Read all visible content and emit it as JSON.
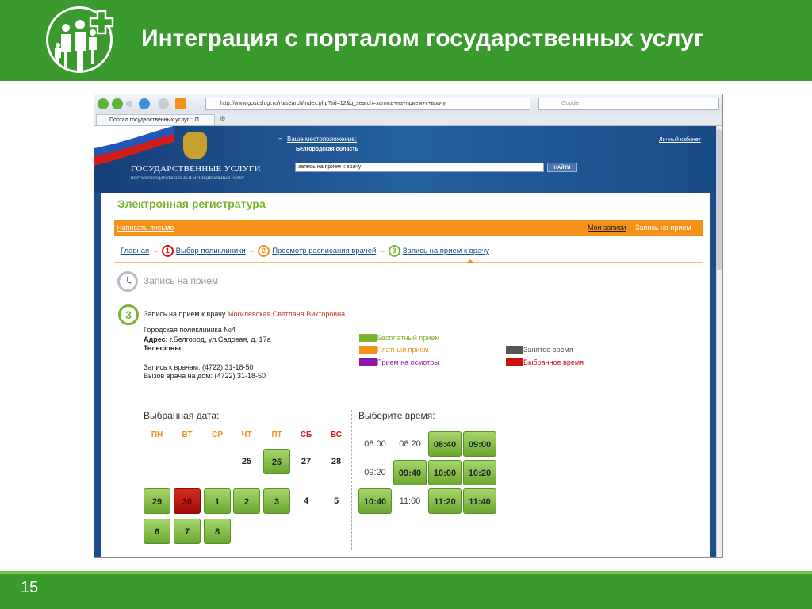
{
  "slide": {
    "title": "Интеграция с порталом государственных услуг",
    "page_number": "15",
    "colors": {
      "brand_green": "#3a9a2e",
      "light_green": "#7bc143"
    }
  },
  "browser": {
    "url": "http://www.gosuslugi.ru/ru/search/index.php?tid=12&q_search=запись+на+прием+к+врачу",
    "search_engine": "Google",
    "tab_title": "Портал государственных услуг :: П..."
  },
  "portal": {
    "location_label": "Ваше местоположение:",
    "location_value": "Белгородская область",
    "title": "ГОСУДАРСТВЕННЫЕ УСЛУГИ",
    "subtitle": "ПОРТАЛ ГОСУДАРСТВЕННЫХ И МУНИЦИПАЛЬНЫХ УСЛУГ",
    "search_value": "запись на прием к врачу",
    "search_button": "НАЙТИ",
    "cabinet_link": "Личный кабинет"
  },
  "registry": {
    "title": "Электронная регистратура",
    "write_letter": "Написать письмо",
    "my_records": "Мои записи",
    "record_link": "Запись на прием",
    "breadcrumb": {
      "home": "Главная",
      "step1_num": "1",
      "step1": "Выбор поликлиники",
      "step2_num": "2",
      "step2": "Просмотр расписания врачей",
      "step3_num": "3",
      "step3": "Запись на прием к врачу"
    },
    "heading": "Запись на прием",
    "step_number": "3",
    "doctor_prefix": "Запись на прием к врачу",
    "doctor_name": "Могилевская Светлана Викторовна",
    "clinic": "Городская поликлиника №4",
    "address_label": "Адрес:",
    "address_value": "г.Белгород, ул.Садовая, д. 17а",
    "phones_label": "Телефоны:",
    "phone_doctors": "Запись к врачам: (4722) 31-18-50",
    "phone_home": "Вызов врача на дом: (4722) 31-18-50",
    "legend": [
      {
        "label": "Бесплатный прием",
        "color": "#7bb32e"
      },
      {
        "label": "Платный прием",
        "color": "#f39118"
      },
      {
        "label": "Прием на осмотры",
        "color": "#8a1aa8"
      },
      {
        "label": "Занятое время",
        "color": "#555555"
      },
      {
        "label": "Выбранное время",
        "color": "#cc1111"
      }
    ],
    "date_label": "Выбранная дата:",
    "time_label": "Выберите время:",
    "weekdays": [
      "ПН",
      "ВТ",
      "СР",
      "ЧТ",
      "ПТ",
      "СБ",
      "ВС"
    ],
    "calendar_week1": [
      "",
      "",
      "",
      "25",
      "26",
      "27",
      "28"
    ],
    "calendar_week2": [
      "29",
      "30",
      "1",
      "2",
      "3",
      "4",
      "5"
    ],
    "calendar_week3": [
      "6",
      "7",
      "8"
    ],
    "times_row1": [
      "08:00",
      "08:20",
      "08:40",
      "09:00"
    ],
    "times_row2": [
      "09:20",
      "09:40",
      "10:00",
      "10:20"
    ],
    "times_row3": [
      "10:40",
      "11:00",
      "11:20",
      "11:40"
    ]
  }
}
